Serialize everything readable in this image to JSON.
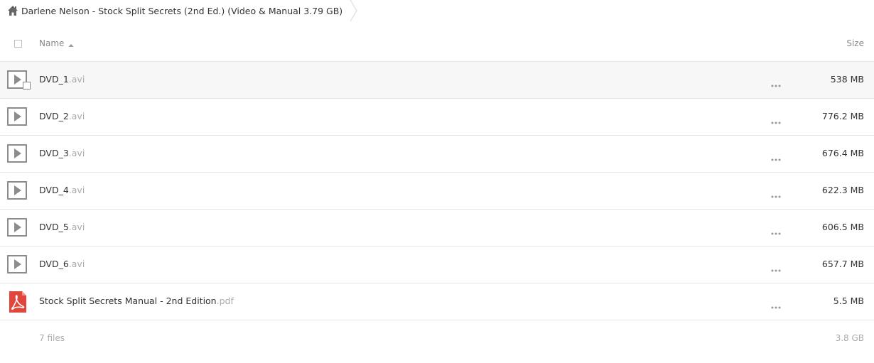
{
  "breadcrumb": {
    "title": "Darlene Nelson - Stock Split Secrets (2nd Ed.) (Video & Manual 3.79 GB)",
    "home_icon": "home-icon"
  },
  "header": {
    "name_label": "Name",
    "size_label": "Size",
    "sort": "ascending"
  },
  "files": [
    {
      "base": "DVD_1",
      "ext": ".avi",
      "size": "538 MB",
      "type": "video",
      "icon": "video-play-icon"
    },
    {
      "base": "DVD_2",
      "ext": ".avi",
      "size": "776.2 MB",
      "type": "video",
      "icon": "video-play-icon"
    },
    {
      "base": "DVD_3",
      "ext": ".avi",
      "size": "676.4 MB",
      "type": "video",
      "icon": "video-play-icon"
    },
    {
      "base": "DVD_4",
      "ext": ".avi",
      "size": "622.3 MB",
      "type": "video",
      "icon": "video-play-icon"
    },
    {
      "base": "DVD_5",
      "ext": ".avi",
      "size": "606.5 MB",
      "type": "video",
      "icon": "video-play-icon"
    },
    {
      "base": "DVD_6",
      "ext": ".avi",
      "size": "657.7 MB",
      "type": "video",
      "icon": "video-play-icon"
    },
    {
      "base": "Stock Split Secrets Manual - 2nd Edition",
      "ext": ".pdf",
      "size": "5.5 MB",
      "type": "pdf",
      "icon": "pdf-icon"
    }
  ],
  "footer": {
    "count": "7 files",
    "total": "3.8 GB"
  },
  "colors": {
    "pdf_red": "#e2453c",
    "video_icon_gray": "#8c8c8c",
    "hover_row": "#f7f7f7"
  }
}
